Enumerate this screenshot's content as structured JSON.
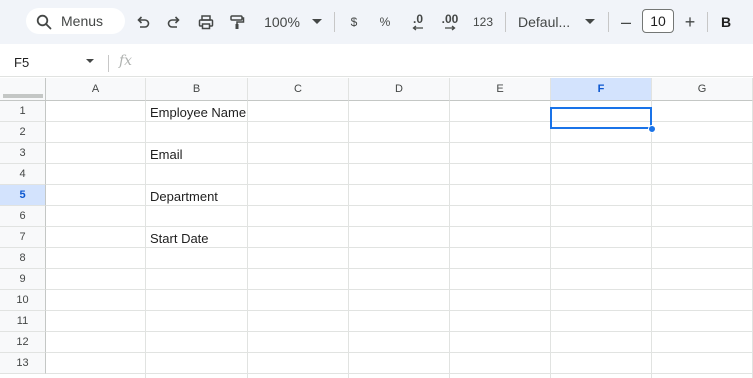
{
  "toolbar": {
    "search_label": "Menus",
    "zoom": "100%",
    "currency_symbol": "$",
    "percent_symbol": "%",
    "decrease_decimal": ".0",
    "increase_decimal": ".00",
    "number_format": "123",
    "font_name": "Defaul...",
    "font_size": "10",
    "bold_label": "B",
    "minus_label": "–",
    "plus_label": "+"
  },
  "formula_bar": {
    "name_box": "F5",
    "fx_label": "fx"
  },
  "grid": {
    "columns": [
      "A",
      "B",
      "C",
      "D",
      "E",
      "F",
      "G"
    ],
    "rows": [
      "1",
      "2",
      "3",
      "4",
      "5",
      "6",
      "7",
      "8",
      "9",
      "10",
      "11",
      "12",
      "13"
    ],
    "active_column": "F",
    "active_row": "5",
    "cells": {
      "B1": "Employee Name",
      "B3": "Email",
      "B5": "Department",
      "B7": "Start Date"
    }
  },
  "colors": {
    "toolbar_bg": "#f1f4f9",
    "selection": "#1a73e8",
    "active_header_bg": "#d3e3fd"
  }
}
